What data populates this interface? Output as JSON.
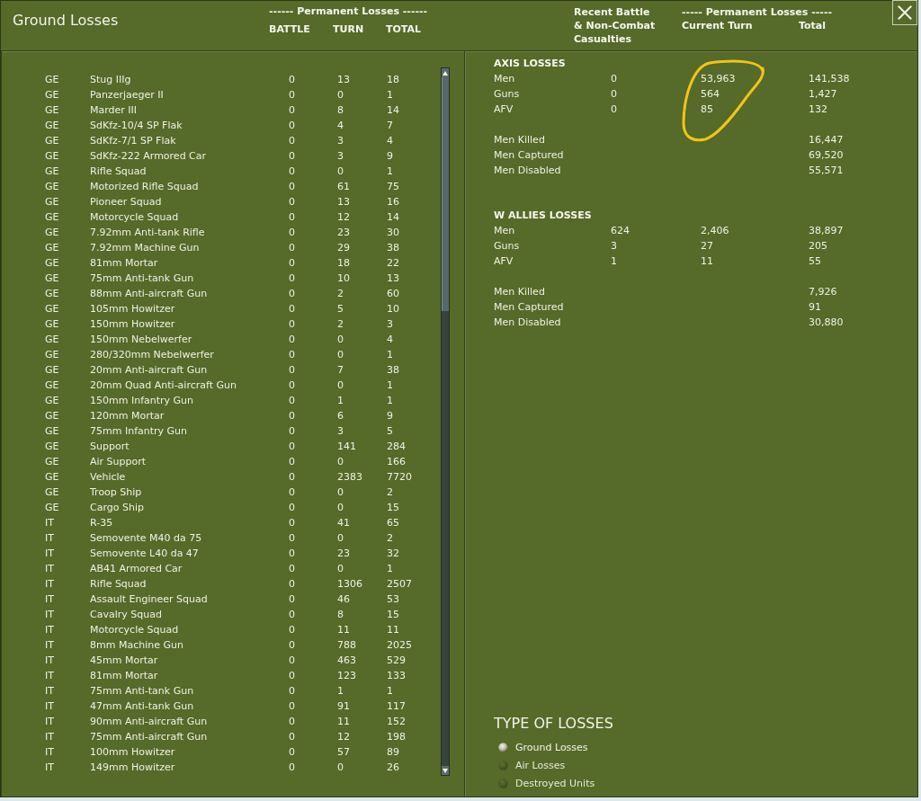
{
  "window": {
    "title": "Ground Losses"
  },
  "left_header": {
    "group_label": "------ Permanent Losses ------",
    "columns": [
      "BATTLE",
      "TURN",
      "TOTAL"
    ]
  },
  "unit_losses": [
    {
      "nation": "GE",
      "unit": "Stug IIIg",
      "battle": "0",
      "turn": "13",
      "total": "18"
    },
    {
      "nation": "GE",
      "unit": "Panzerjaeger II",
      "battle": "0",
      "turn": "0",
      "total": "1"
    },
    {
      "nation": "GE",
      "unit": "Marder III",
      "battle": "0",
      "turn": "8",
      "total": "14"
    },
    {
      "nation": "GE",
      "unit": "SdKfz-10/4 SP Flak",
      "battle": "0",
      "turn": "4",
      "total": "7"
    },
    {
      "nation": "GE",
      "unit": "SdKfz-7/1 SP Flak",
      "battle": "0",
      "turn": "3",
      "total": "4"
    },
    {
      "nation": "GE",
      "unit": "SdKfz-222 Armored Car",
      "battle": "0",
      "turn": "3",
      "total": "9"
    },
    {
      "nation": "GE",
      "unit": "Rifle Squad",
      "battle": "0",
      "turn": "0",
      "total": "1"
    },
    {
      "nation": "GE",
      "unit": "Motorized Rifle Squad",
      "battle": "0",
      "turn": "61",
      "total": "75"
    },
    {
      "nation": "GE",
      "unit": "Pioneer Squad",
      "battle": "0",
      "turn": "13",
      "total": "16"
    },
    {
      "nation": "GE",
      "unit": "Motorcycle Squad",
      "battle": "0",
      "turn": "12",
      "total": "14"
    },
    {
      "nation": "GE",
      "unit": "7.92mm Anti-tank Rifle",
      "battle": "0",
      "turn": "23",
      "total": "30"
    },
    {
      "nation": "GE",
      "unit": "7.92mm Machine Gun",
      "battle": "0",
      "turn": "29",
      "total": "38"
    },
    {
      "nation": "GE",
      "unit": "81mm Mortar",
      "battle": "0",
      "turn": "18",
      "total": "22"
    },
    {
      "nation": "GE",
      "unit": "75mm Anti-tank Gun",
      "battle": "0",
      "turn": "10",
      "total": "13"
    },
    {
      "nation": "GE",
      "unit": "88mm Anti-aircraft Gun",
      "battle": "0",
      "turn": "2",
      "total": "60"
    },
    {
      "nation": "GE",
      "unit": "105mm Howitzer",
      "battle": "0",
      "turn": "5",
      "total": "10"
    },
    {
      "nation": "GE",
      "unit": "150mm Howitzer",
      "battle": "0",
      "turn": "2",
      "total": "3"
    },
    {
      "nation": "GE",
      "unit": "150mm Nebelwerfer",
      "battle": "0",
      "turn": "0",
      "total": "4"
    },
    {
      "nation": "GE",
      "unit": "280/320mm Nebelwerfer",
      "battle": "0",
      "turn": "0",
      "total": "1"
    },
    {
      "nation": "GE",
      "unit": "20mm Anti-aircraft Gun",
      "battle": "0",
      "turn": "7",
      "total": "38"
    },
    {
      "nation": "GE",
      "unit": "20mm Quad Anti-aircraft Gun",
      "battle": "0",
      "turn": "0",
      "total": "1"
    },
    {
      "nation": "GE",
      "unit": "150mm Infantry Gun",
      "battle": "0",
      "turn": "1",
      "total": "1"
    },
    {
      "nation": "GE",
      "unit": "120mm Mortar",
      "battle": "0",
      "turn": "6",
      "total": "9"
    },
    {
      "nation": "GE",
      "unit": "75mm Infantry Gun",
      "battle": "0",
      "turn": "3",
      "total": "5"
    },
    {
      "nation": "GE",
      "unit": "Support",
      "battle": "0",
      "turn": "141",
      "total": "284"
    },
    {
      "nation": "GE",
      "unit": "Air Support",
      "battle": "0",
      "turn": "0",
      "total": "166"
    },
    {
      "nation": "GE",
      "unit": "Vehicle",
      "battle": "0",
      "turn": "2383",
      "total": "7720"
    },
    {
      "nation": "GE",
      "unit": "Troop Ship",
      "battle": "0",
      "turn": "0",
      "total": "2"
    },
    {
      "nation": "GE",
      "unit": "Cargo Ship",
      "battle": "0",
      "turn": "0",
      "total": "15"
    },
    {
      "nation": "IT",
      "unit": "R-35",
      "battle": "0",
      "turn": "41",
      "total": "65"
    },
    {
      "nation": "IT",
      "unit": "Semovente M40 da 75",
      "battle": "0",
      "turn": "0",
      "total": "2"
    },
    {
      "nation": "IT",
      "unit": "Semovente L40 da 47",
      "battle": "0",
      "turn": "23",
      "total": "32"
    },
    {
      "nation": "IT",
      "unit": "AB41 Armored Car",
      "battle": "0",
      "turn": "0",
      "total": "1"
    },
    {
      "nation": "IT",
      "unit": "Rifle Squad",
      "battle": "0",
      "turn": "1306",
      "total": "2507"
    },
    {
      "nation": "IT",
      "unit": "Assault Engineer Squad",
      "battle": "0",
      "turn": "46",
      "total": "53"
    },
    {
      "nation": "IT",
      "unit": "Cavalry Squad",
      "battle": "0",
      "turn": "8",
      "total": "15"
    },
    {
      "nation": "IT",
      "unit": "Motorcycle Squad",
      "battle": "0",
      "turn": "11",
      "total": "11"
    },
    {
      "nation": "IT",
      "unit": "8mm Machine Gun",
      "battle": "0",
      "turn": "788",
      "total": "2025"
    },
    {
      "nation": "IT",
      "unit": "45mm Mortar",
      "battle": "0",
      "turn": "463",
      "total": "529"
    },
    {
      "nation": "IT",
      "unit": "81mm Mortar",
      "battle": "0",
      "turn": "123",
      "total": "133"
    },
    {
      "nation": "IT",
      "unit": "75mm Anti-tank Gun",
      "battle": "0",
      "turn": "1",
      "total": "1"
    },
    {
      "nation": "IT",
      "unit": "47mm Anti-tank Gun",
      "battle": "0",
      "turn": "91",
      "total": "117"
    },
    {
      "nation": "IT",
      "unit": "90mm Anti-aircraft Gun",
      "battle": "0",
      "turn": "11",
      "total": "152"
    },
    {
      "nation": "IT",
      "unit": "75mm Anti-aircraft Gun",
      "battle": "0",
      "turn": "12",
      "total": "198"
    },
    {
      "nation": "IT",
      "unit": "100mm Howitzer",
      "battle": "0",
      "turn": "57",
      "total": "89"
    },
    {
      "nation": "IT",
      "unit": "149mm Howitzer",
      "battle": "0",
      "turn": "0",
      "total": "26"
    }
  ],
  "right_header": {
    "recent_heading": [
      "Recent Battle",
      "& Non-Combat",
      "Casualties"
    ],
    "group_label": "----- Permanent Losses -----",
    "columns": [
      "Current Turn",
      "Total"
    ]
  },
  "sections": [
    {
      "title": "AXIS LOSSES",
      "rows": [
        {
          "label": "Men",
          "recent": "0",
          "current": "53,963",
          "total": "141,538"
        },
        {
          "label": "Guns",
          "recent": "0",
          "current": "564",
          "total": "1,427"
        },
        {
          "label": "AFV",
          "recent": "0",
          "current": "85",
          "total": "132"
        }
      ],
      "breakdown": [
        {
          "label": "Men Killed",
          "total": "16,447"
        },
        {
          "label": "Men Captured",
          "total": "69,520"
        },
        {
          "label": "Men Disabled",
          "total": "55,571"
        }
      ]
    },
    {
      "title": "W ALLIES LOSSES",
      "rows": [
        {
          "label": "Men",
          "recent": "624",
          "current": "2,406",
          "total": "38,897"
        },
        {
          "label": "Guns",
          "recent": "3",
          "current": "27",
          "total": "205"
        },
        {
          "label": "AFV",
          "recent": "1",
          "current": "11",
          "total": "55"
        }
      ],
      "breakdown": [
        {
          "label": "Men Killed",
          "total": "7,926"
        },
        {
          "label": "Men Captured",
          "total": "91"
        },
        {
          "label": "Men Disabled",
          "total": "30,880"
        }
      ]
    }
  ],
  "type_of_losses": {
    "title": "TYPE OF LOSSES",
    "options": [
      {
        "label": "Ground Losses",
        "selected": true
      },
      {
        "label": "Air Losses",
        "selected": false
      },
      {
        "label": "Destroyed Units",
        "selected": false
      }
    ]
  },
  "annotations": [
    {
      "kind": "loop"
    }
  ]
}
